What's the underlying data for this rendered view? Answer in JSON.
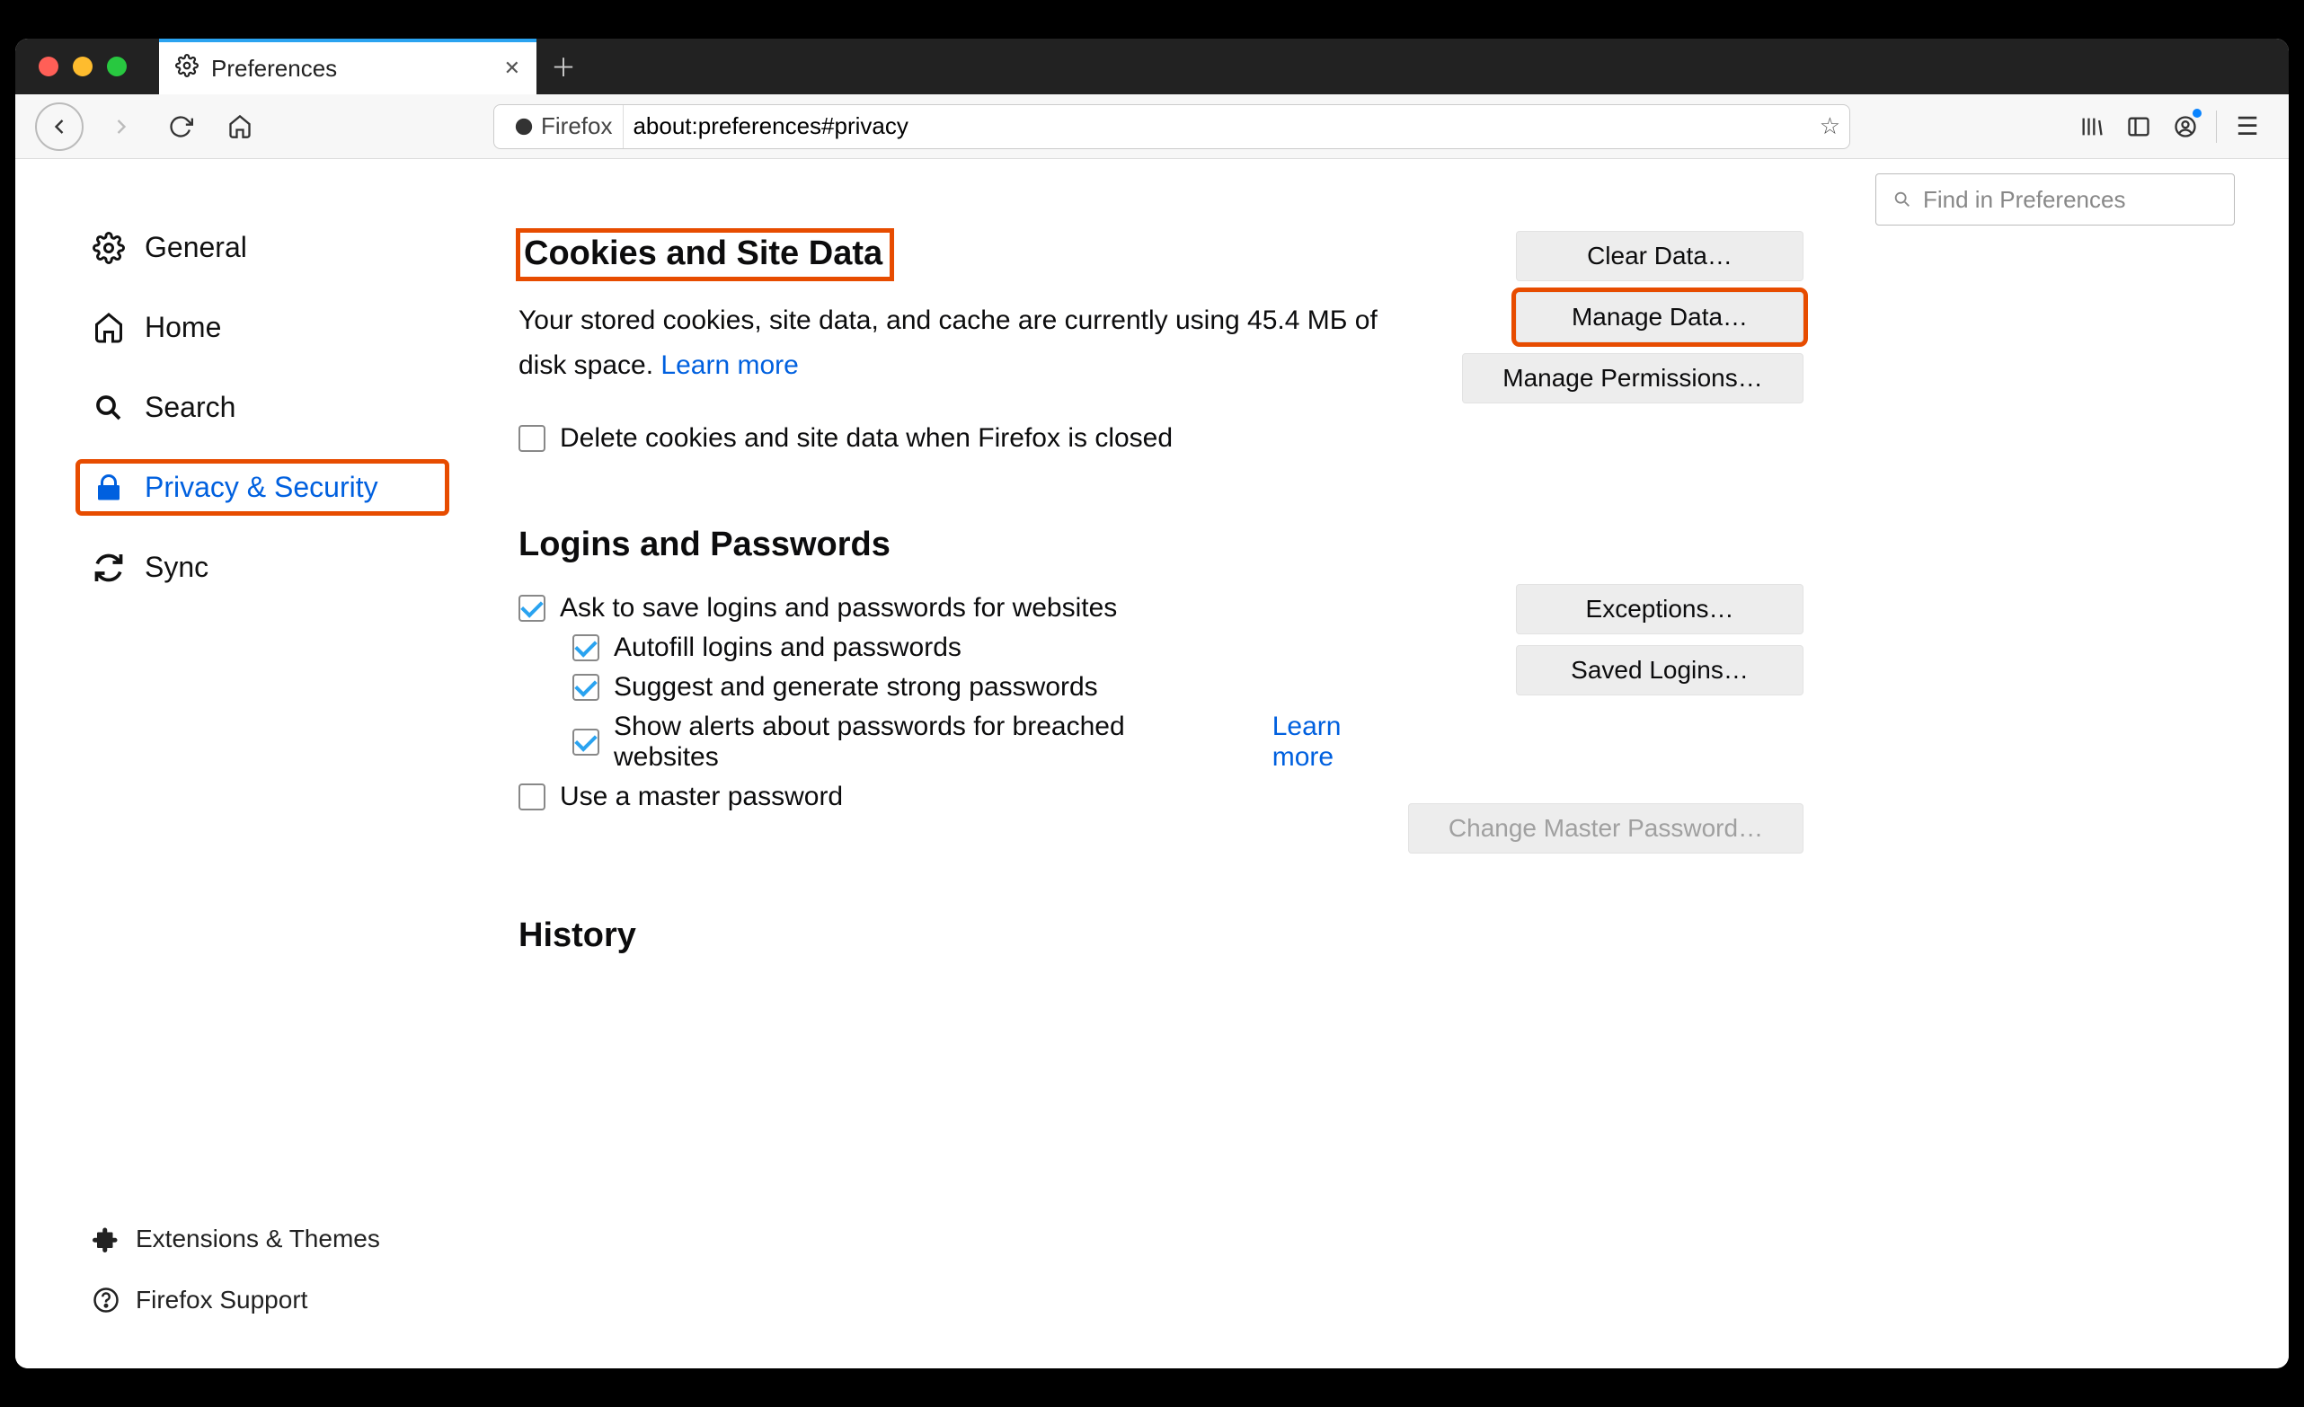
{
  "tab": {
    "title": "Preferences"
  },
  "urlbar": {
    "browser_label": "Firefox",
    "url": "about:preferences#privacy"
  },
  "search_placeholder": "Find in Preferences",
  "sidebar": {
    "items": [
      {
        "label": "General"
      },
      {
        "label": "Home"
      },
      {
        "label": "Search"
      },
      {
        "label": "Privacy & Security"
      },
      {
        "label": "Sync"
      }
    ],
    "bottom": [
      {
        "label": "Extensions & Themes"
      },
      {
        "label": "Firefox Support"
      }
    ]
  },
  "cookies": {
    "heading": "Cookies and Site Data",
    "desc_prefix": "Your stored cookies, site data, and cache are currently using ",
    "disk_usage": "45.4 МБ",
    "desc_suffix": " of disk space.  ",
    "learn_more": "Learn more",
    "delete_on_close": "Delete cookies and site data when Firefox is closed",
    "buttons": {
      "clear": "Clear Data…",
      "manage": "Manage Data…",
      "perms": "Manage Permissions…"
    }
  },
  "logins": {
    "heading": "Logins and Passwords",
    "ask_save": "Ask to save logins and passwords for websites",
    "autofill": "Autofill logins and passwords",
    "suggest": "Suggest and generate strong passwords",
    "alerts": "Show alerts about passwords for breached websites",
    "learn_more": "Learn more",
    "use_master": "Use a master password",
    "buttons": {
      "exceptions": "Exceptions…",
      "saved": "Saved Logins…",
      "change_master": "Change Master Password…"
    }
  },
  "history": {
    "heading": "History"
  }
}
